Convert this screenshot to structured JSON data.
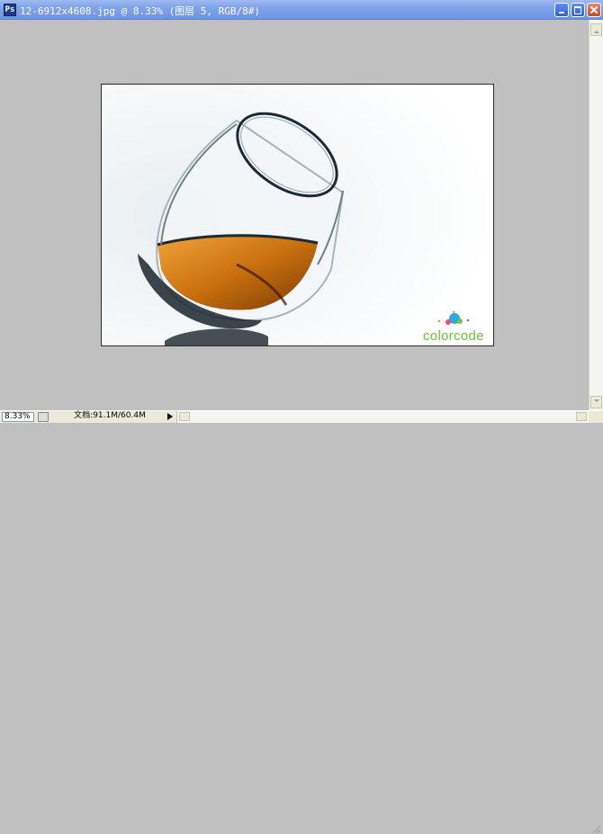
{
  "window": {
    "title": "12-6912x4608.jpg @ 8.33% (图层 5, RGB/8#)",
    "app_icon_label": "Ps",
    "buttons": [
      "minimize-icon",
      "maximize-icon",
      "close-icon"
    ]
  },
  "canvas": {
    "background_color": "#c0c0c0",
    "image_description_icons": [
      "brandy-glass-photo"
    ],
    "watermark": {
      "text": "colorcode",
      "text_color": "#6cbf3c"
    }
  },
  "status": {
    "zoom": "8.33%",
    "doc_info": "文档:91.1M/60.4M"
  },
  "colors": {
    "titlebar": "#7fa3ea",
    "liquid": "#c9700f"
  }
}
